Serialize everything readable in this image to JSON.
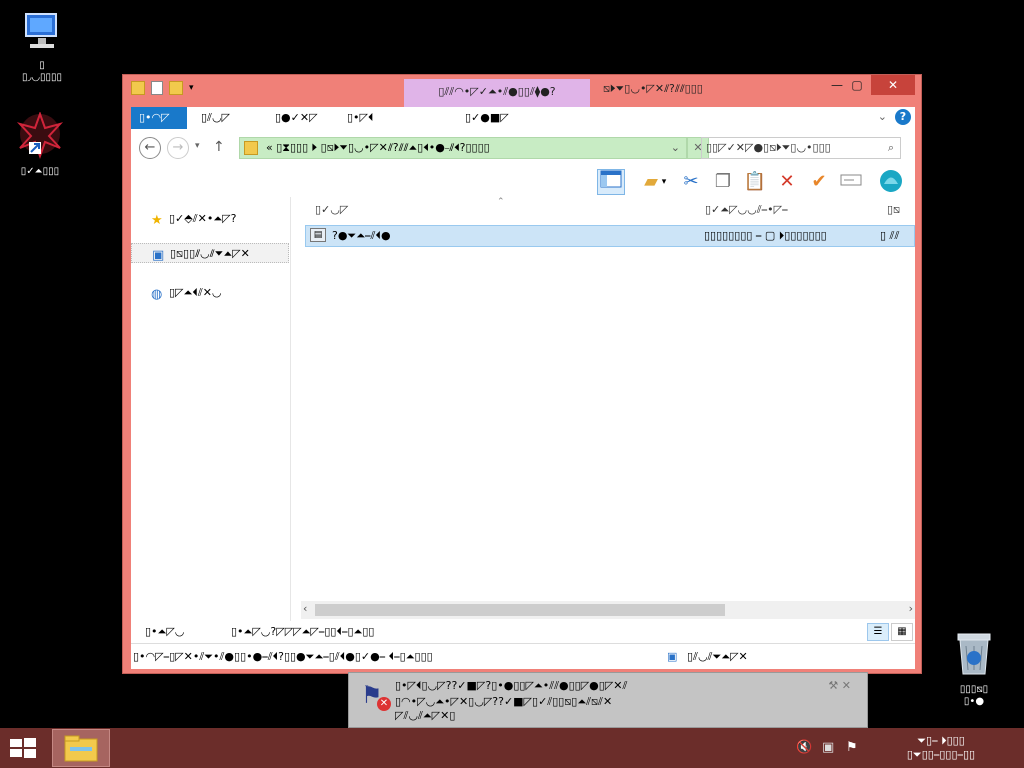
{
  "desktop": {
    "icons": [
      {
        "name": "computer",
        "label": "▯\n▯◞◡▯▯▯▯"
      },
      {
        "name": "app",
        "label": "▯✓⏶▯▯▯"
      },
      {
        "name": "recycle-bin",
        "label": "▯▯▯⧅▯\n▯•●"
      }
    ]
  },
  "window": {
    "context_tab": "▯⫽⫽◠•◸✓⏶•⫽●▯▯⫽⧫●?",
    "title": "⧅⏵⏷▯◡•◸✕⫽?⫽⫽▯▯▯",
    "minimize": "—",
    "maximize": "▢",
    "close": "✕"
  },
  "ribbon": {
    "tabs": [
      "▯•◠◸",
      "▯⫽◡◸",
      "▯●✓✕◸",
      "▯•◸⏴",
      "▯✓●■◸"
    ],
    "help": "?"
  },
  "address": {
    "back": "←",
    "forward": "→",
    "up": "↑",
    "path": "« ▯⧗▯▯▯ ⏵ ▯⧅⏵⏷▯◡•◸✕⫽?⫽⫽⏶▯⏴•●⎯⫽⏴?▯▯▯▯",
    "clear": "✕",
    "search_placeholder": "▯▯◸✓✕◸●▯⧅⏵⏷▯◡•▯▯▯"
  },
  "toolbar": {
    "icons": [
      "layout-icon",
      "folder-check-icon",
      "cut-icon",
      "copy-icon",
      "paste-icon",
      "delete-icon",
      "check-icon",
      "rename-icon",
      "shell-icon"
    ]
  },
  "navpane": {
    "items": [
      {
        "icon": "★",
        "label": "▯✓⬘⫽✕•⏶◸?"
      },
      {
        "icon": "🖥",
        "label": "▯⧅▯▯⫽◡⫽⏷⏶◸✕"
      },
      {
        "icon": "🌐",
        "label": "▯◸⏶⏴⫽✕◡"
      }
    ]
  },
  "content": {
    "columns": {
      "name": "▯✓◡◸",
      "date": "▯✓⏶◸◡◡⫽⎯•◸⎯",
      "type": "▯⧅"
    },
    "rows": [
      {
        "name": "?●⏷⏶⎯⫽⏴●",
        "date": "▯▯▯▯▯▯▯▯ ⎯ ▢ ⏵▯▯▯▯▯▯▯",
        "type": "▯ ⫽⫽"
      }
    ]
  },
  "status": {
    "items": "▯•⏶◸◡",
    "selected": "▯•⏶◸◡?◸◸◸⏶◸⎯▯▯⏴⎯▯⏶▯▯"
  },
  "details": {
    "text": "▯•◠◸⎯▯◸✕•⫽⏷•⫽●▯▯•●⎯⫽⏴?▯▯●⏷⏶⎯▯⫽⏴●▯✓●⎯ ⏴⎯▯⏶▯▯▯",
    "location": "▯⫽◡⫽⏷⏶◸✕"
  },
  "balloon": {
    "title": "▯•◸⏴▯◡◸??✓■◸?▯•●▯▯◸⏶•⫽⫽●▯▯◸●▯◸✕⫽",
    "body": "▯◠•◸◡⏶•◸✕▯◡◸??✓■◸▯✓⫽▯▯⧅▯⏶⫽⧅⫽✕\n◸⫽◡⫽⏶◸✕▯",
    "controls": "⚒ ✕"
  },
  "taskbar": {
    "clock_time": "⏷▯⎯ ⏵▯▯▯",
    "clock_date": "▯⏷▯▯⎯▯▯▯⎯▯▯"
  },
  "colors": {
    "window_border": "#f08078",
    "accent": "#1979ca",
    "taskbar": "#6b2d2a",
    "selection": "#cce4f7"
  }
}
